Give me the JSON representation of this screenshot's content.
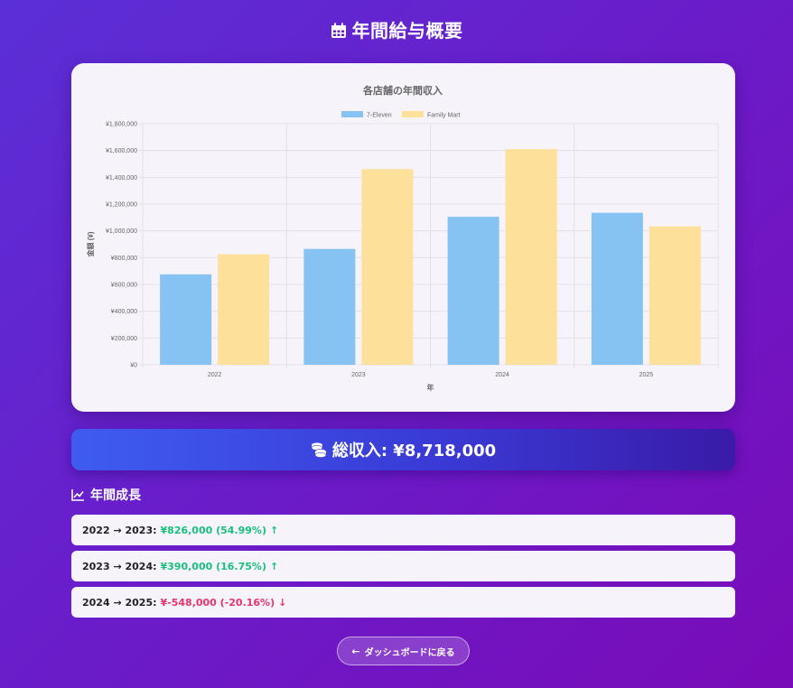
{
  "page": {
    "title": "年間給与概要"
  },
  "chart_data": {
    "type": "bar",
    "title": "各店舗の年間収入",
    "categories": [
      "2022",
      "2023",
      "2024",
      "2025"
    ],
    "series": [
      {
        "name": "7-Eleven",
        "values": [
          675000,
          865000,
          1105000,
          1135000
        ],
        "color": "#86c3f2"
      },
      {
        "name": "Family Mart",
        "values": [
          825000,
          1461000,
          1611000,
          1033000
        ],
        "color": "#fde09a"
      }
    ],
    "xlabel": "年",
    "ylabel": "金額 (¥)",
    "ylim": [
      0,
      1800000
    ],
    "yticks": [
      "¥0",
      "¥200,000",
      "¥400,000",
      "¥600,000",
      "¥800,000",
      "¥1,000,000",
      "¥1,200,000",
      "¥1,400,000",
      "¥1,600,000",
      "¥1,800,000"
    ],
    "grid": true,
    "legend": "top"
  },
  "total": {
    "label": "総収入: ¥8,718,000"
  },
  "growth": {
    "heading": "年間成長",
    "items": [
      {
        "period": "2022 → 2023:",
        "value": "¥826,000 (54.99%)",
        "arrow": "↑",
        "trend": "up"
      },
      {
        "period": "2023 → 2024:",
        "value": "¥390,000 (16.75%)",
        "arrow": "↑",
        "trend": "up"
      },
      {
        "period": "2024 → 2025:",
        "value": "¥-548,000 (-20.16%)",
        "arrow": "↓",
        "trend": "down"
      }
    ]
  },
  "back_button": {
    "label": "ダッシュボードに戻る"
  }
}
